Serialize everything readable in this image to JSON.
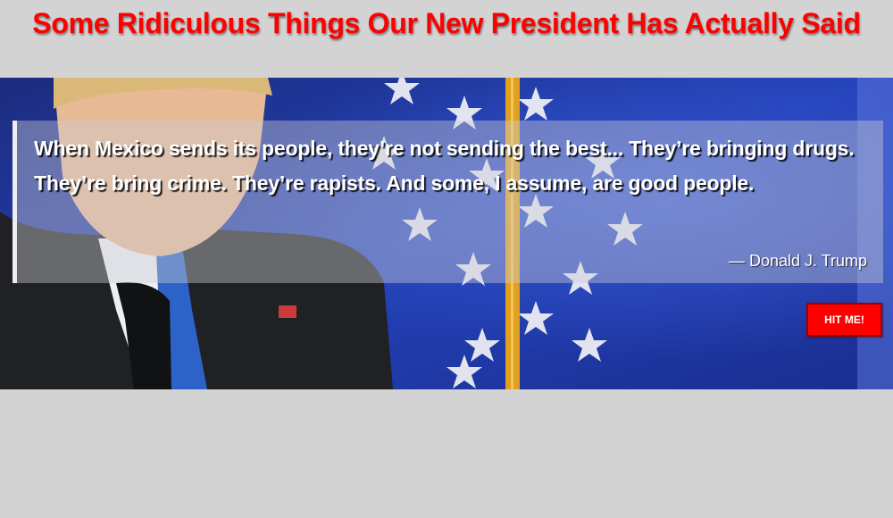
{
  "page": {
    "title": "Some Ridiculous Things Our New President Has Actually Said"
  },
  "quote": {
    "text": "When Mexico sends its people, they’re not sending the best... They’re bringing drugs. They’re bring crime. They’re rapists. And some, I assume, are good people.",
    "author": "— Donald J. Trump"
  },
  "button": {
    "label": "HIT ME!"
  },
  "colors": {
    "background": "#d3d3d3",
    "title": "#ff0000",
    "button": "#ff0000",
    "flag_blue": "#1b2f8a"
  },
  "hero_image": {
    "icon": "speaker-at-podium-with-flag-photo"
  }
}
